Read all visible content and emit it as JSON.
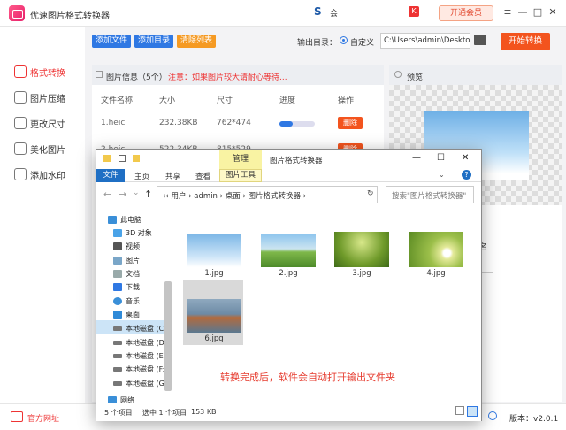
{
  "app": {
    "title": "优速图片格式转换器",
    "lang": "会",
    "vip_button": "开通会员",
    "window_buttons": [
      "≡",
      "—",
      "□",
      "✕"
    ]
  },
  "sidebar": {
    "items": [
      {
        "label": "格式转换",
        "icon": "convert-icon",
        "active": true
      },
      {
        "label": "图片压缩",
        "icon": "compress-icon",
        "active": false
      },
      {
        "label": "更改尺寸",
        "icon": "resize-icon",
        "active": false
      },
      {
        "label": "美化图片",
        "icon": "beautify-icon",
        "active": false
      },
      {
        "label": "添加水印",
        "icon": "watermark-icon",
        "active": false
      }
    ]
  },
  "toolbar": {
    "add_file": "添加文件",
    "add_folder": "添加目录",
    "clear_list": "清除列表",
    "output_label": "输出目录：",
    "custom_label": "自定义",
    "output_path": "C:\\Users\\admin\\Deskto",
    "start_button": "开始转换",
    "colors": {
      "blue": "#2f78e3",
      "orange": "#f59a23",
      "red": "#f3541e"
    }
  },
  "info": {
    "title": "图片信息（5个）",
    "warning": "注意：如果图片较大请耐心等待...",
    "columns": [
      "文件名称",
      "大小",
      "尺寸",
      "进度",
      "操作"
    ],
    "rows": [
      {
        "name": "1.heic",
        "size": "232.38KB",
        "dims": "762*474",
        "progress": 0.38,
        "action": "删除"
      },
      {
        "name": "2.heic",
        "size": "522.34KB",
        "dims": "815*529",
        "progress": 0.38,
        "action": "删除"
      }
    ]
  },
  "preview": {
    "title": "预览",
    "partial_label": "名"
  },
  "footer": {
    "site": "官方网址",
    "version": "版本：v2.0.1"
  },
  "explorer": {
    "manage_tab": "管理",
    "title": "图片格式转换器",
    "window_buttons": [
      "—",
      "☐",
      "✕"
    ],
    "ribbon_tabs": [
      "文件",
      "主页",
      "共享",
      "查看"
    ],
    "picture_tools": "图片工具",
    "address": "‹‹  用户  ›  admin  ›  桌面  ›  图片格式转换器  ›",
    "search_placeholder": "搜索\"图片格式转换器\"",
    "nav": [
      {
        "label": "此电脑",
        "icon": "pc-icon"
      },
      {
        "label": "3D 对象",
        "icon": "3d-objects-icon"
      },
      {
        "label": "视频",
        "icon": "video-icon"
      },
      {
        "label": "图片",
        "icon": "pictures-icon"
      },
      {
        "label": "文档",
        "icon": "documents-icon"
      },
      {
        "label": "下载",
        "icon": "download-icon"
      },
      {
        "label": "音乐",
        "icon": "music-icon"
      },
      {
        "label": "桌面",
        "icon": "desktop-icon"
      },
      {
        "label": "本地磁盘 (C:",
        "icon": "drive-icon"
      },
      {
        "label": "本地磁盘 (D:",
        "icon": "drive-icon"
      },
      {
        "label": "本地磁盘 (E:",
        "icon": "drive-icon"
      },
      {
        "label": "本地磁盘 (F:",
        "icon": "drive-icon"
      },
      {
        "label": "本地磁盘 (G:",
        "icon": "drive-icon"
      },
      {
        "label": "网络",
        "icon": "network-icon"
      }
    ],
    "files": [
      "1.jpg",
      "2.jpg",
      "3.jpg",
      "4.jpg",
      "6.jpg"
    ],
    "message": "转换完成后，软件会自动打开输出文件夹",
    "status": {
      "count": "5 个项目",
      "selected": "选中 1 个项目",
      "size": "153 KB"
    }
  }
}
